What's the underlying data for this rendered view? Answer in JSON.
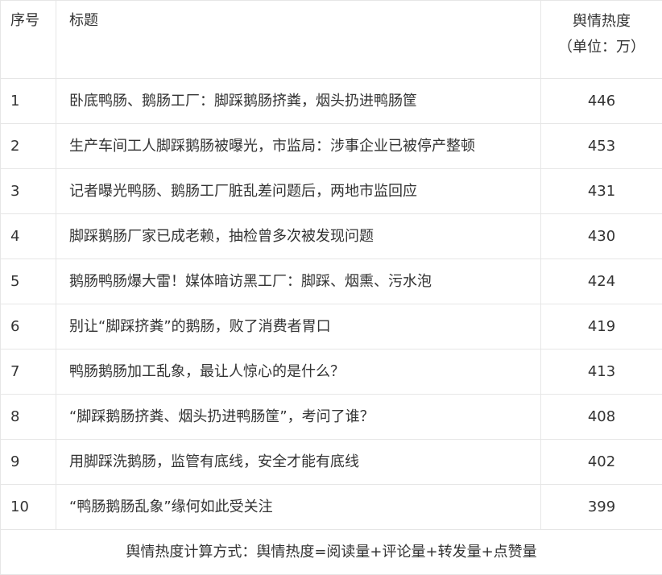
{
  "header": {
    "index": "序号",
    "title": "标题",
    "heat_label": "舆情热度",
    "heat_unit": "（单位：万）"
  },
  "rows": [
    {
      "index": "1",
      "title": "卧底鸭肠、鹅肠工厂：脚踩鹅肠挤粪，烟头扔进鸭肠筐",
      "heat": "446"
    },
    {
      "index": "2",
      "title": "生产车间工人脚踩鹅肠被曝光，市监局：涉事企业已被停产整顿",
      "heat": "453"
    },
    {
      "index": "3",
      "title": "记者曝光鸭肠、鹅肠工厂脏乱差问题后，两地市监回应",
      "heat": "431"
    },
    {
      "index": "4",
      "title": "脚踩鹅肠厂家已成老赖，抽检曾多次被发现问题",
      "heat": "430"
    },
    {
      "index": "5",
      "title": "鹅肠鸭肠爆大雷！媒体暗访黑工厂：脚踩、烟熏、污水泡",
      "heat": "424"
    },
    {
      "index": "6",
      "title": "别让“脚踩挤粪”的鹅肠，败了消费者胃口",
      "heat": "419"
    },
    {
      "index": "7",
      "title": "鸭肠鹅肠加工乱象，最让人惊心的是什么？",
      "heat": "413"
    },
    {
      "index": "8",
      "title": "“脚踩鹅肠挤粪、烟头扔进鸭肠筐”，考问了谁？",
      "heat": "408"
    },
    {
      "index": "9",
      "title": "用脚踩洗鹅肠，监管有底线，安全才能有底线",
      "heat": "402"
    },
    {
      "index": "10",
      "title": "“鸭肠鹅肠乱象”缘何如此受关注",
      "heat": "399"
    }
  ],
  "footer": {
    "note": "舆情热度计算方式：舆情热度=阅读量+评论量+转发量+点赞量"
  }
}
